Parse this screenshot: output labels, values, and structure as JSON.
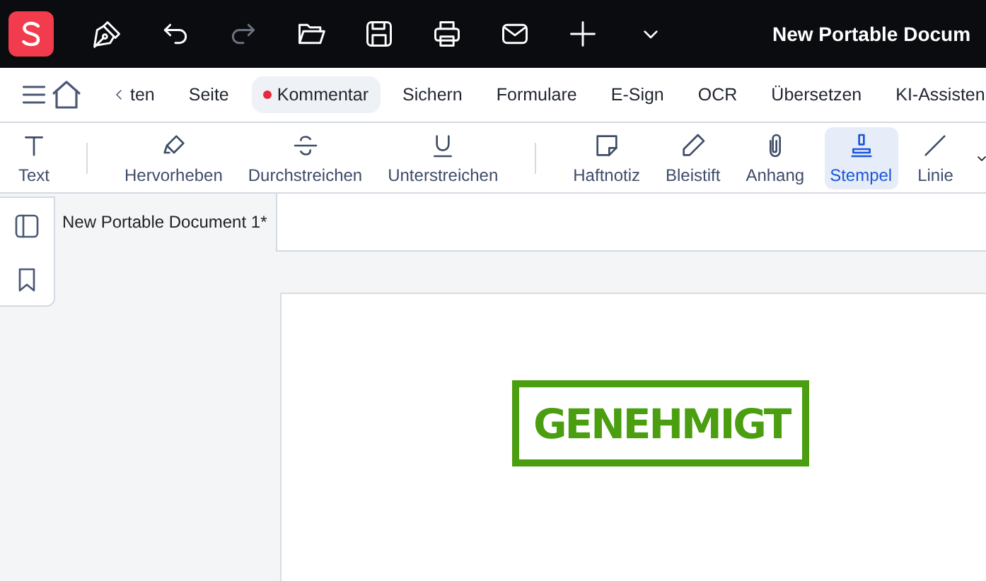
{
  "window": {
    "title": "New Portable Docum"
  },
  "nav": {
    "items": [
      {
        "label": "ten",
        "selected": false
      },
      {
        "label": "Seite",
        "selected": false
      },
      {
        "label": "Kommentar",
        "selected": true
      },
      {
        "label": "Sichern",
        "selected": false
      },
      {
        "label": "Formulare",
        "selected": false
      },
      {
        "label": "E-Sign",
        "selected": false
      },
      {
        "label": "OCR",
        "selected": false
      },
      {
        "label": "Übersetzen",
        "selected": false
      },
      {
        "label": "KI-Assisten",
        "selected": false
      }
    ]
  },
  "toolbar": {
    "tools": [
      {
        "label": "Text",
        "selected": false
      },
      {
        "label": "Hervorheben",
        "selected": false
      },
      {
        "label": "Durchstreichen",
        "selected": false
      },
      {
        "label": "Unterstreichen",
        "selected": false
      },
      {
        "label": "Haftnotiz",
        "selected": false
      },
      {
        "label": "Bleistift",
        "selected": false
      },
      {
        "label": "Anhang",
        "selected": false
      },
      {
        "label": "Stempel",
        "selected": true
      },
      {
        "label": "Linie",
        "selected": false
      }
    ]
  },
  "document": {
    "tab": {
      "label": "New Portable Document 1*"
    },
    "stamp": {
      "label": "GENEHMIGT"
    }
  }
}
